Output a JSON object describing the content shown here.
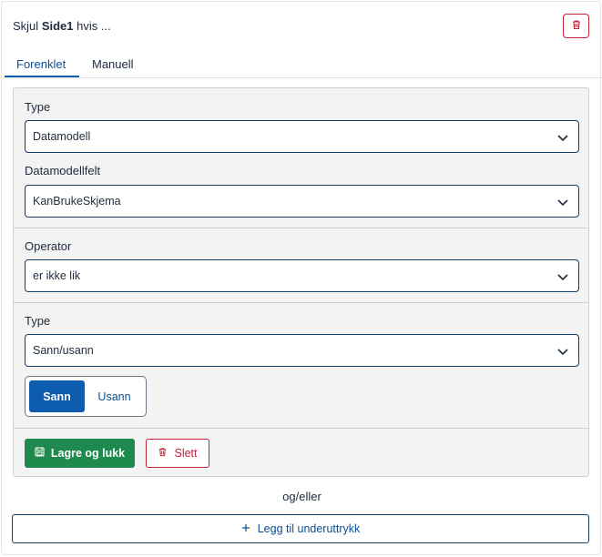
{
  "header": {
    "prefix": "Skjul",
    "page": "Side1",
    "suffix": "hvis ..."
  },
  "tabs": [
    {
      "label": "Forenklet",
      "active": true
    },
    {
      "label": "Manuell",
      "active": false
    }
  ],
  "form": {
    "type_label": "Type",
    "type_value": "Datamodell",
    "field_label": "Datamodellfelt",
    "field_value": "KanBrukeSkjema",
    "operator_label": "Operator",
    "operator_value": "er ikke lik",
    "value_type_label": "Type",
    "value_type_value": "Sann/usann",
    "toggle": {
      "true_label": "Sann",
      "false_label": "Usann",
      "selected": "Sann"
    }
  },
  "actions": {
    "save_label": "Lagre og lukk",
    "delete_label": "Slett"
  },
  "andor_label": "og/eller",
  "add_label": "Legg til underuttrykk",
  "icons": {
    "delete": "trash-icon",
    "select": "chevron-down-icon",
    "save": "save-icon",
    "add": "plus-icon"
  },
  "colors": {
    "primary": "#0d5cb0",
    "success": "#1e8a4e",
    "danger": "#c3233b"
  }
}
